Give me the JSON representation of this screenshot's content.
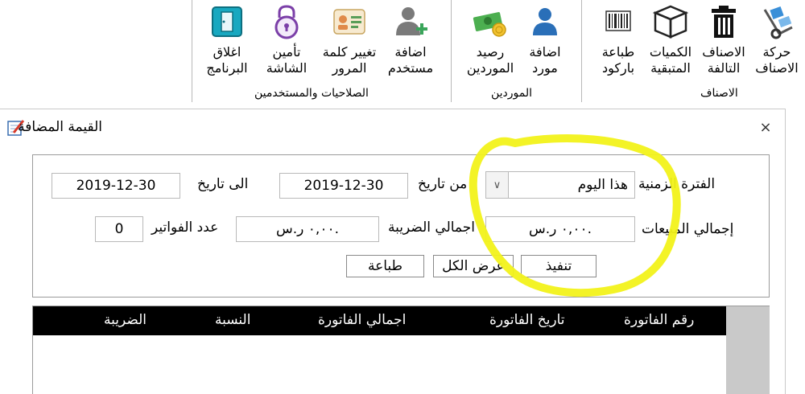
{
  "ribbon": {
    "groups": {
      "items_group": "الاصناف",
      "suppliers_group": "الموردين",
      "users_group": "الصلاحيات والمستخدمين"
    },
    "buttons": {
      "items_movement": [
        "حركة",
        "الاصناف"
      ],
      "damaged_items": [
        "الاصناف",
        "التالفة"
      ],
      "remaining_qty": [
        "الكميات",
        "المتبقية"
      ],
      "print_barcode": [
        "طباعة",
        "باركود"
      ],
      "add_supplier": [
        "اضافة",
        "مورد"
      ],
      "suppliers_balance": [
        "رصيد",
        "الموردين"
      ],
      "add_user": [
        "اضافة",
        "مستخدم"
      ],
      "change_password": [
        "تغيير كلمة",
        "المرور"
      ],
      "lock_screen": [
        "تأمين",
        "الشاشة"
      ],
      "close_app": [
        "اغلاق",
        "البرنامج"
      ]
    }
  },
  "dialog": {
    "title": "القيمة المضافة",
    "close": "×",
    "filters": {
      "period_label": "الفترة الزمنية",
      "period_value": "هذا اليوم",
      "from_label": "من تاريخ",
      "from_value": "2019-12-30",
      "to_label": "الى تاريخ",
      "to_value": "2019-12-30",
      "total_sales_label": "إجمالي المبيعات",
      "total_sales_value": "٠,٠٠ ر.س.",
      "total_tax_label": "اجمالي الضريبة",
      "total_tax_value": "٠,٠٠ ر.س.",
      "invoice_count_label": "عدد الفواتير",
      "invoice_count_value": "0"
    },
    "buttons": {
      "execute": "تنفيذ",
      "show_all": "عرض الكل",
      "print": "طباعة"
    },
    "table": {
      "columns": [
        "رقم الفاتورة",
        "تاريخ الفاتورة",
        "اجمالي الفاتورة",
        "النسبة",
        "الضريبة"
      ]
    }
  },
  "colors": {
    "highlight": "#f2f21a",
    "header_bg": "#000000",
    "scrollbar": "#c9c9c9",
    "accent_blue": "#2a6fb8"
  }
}
